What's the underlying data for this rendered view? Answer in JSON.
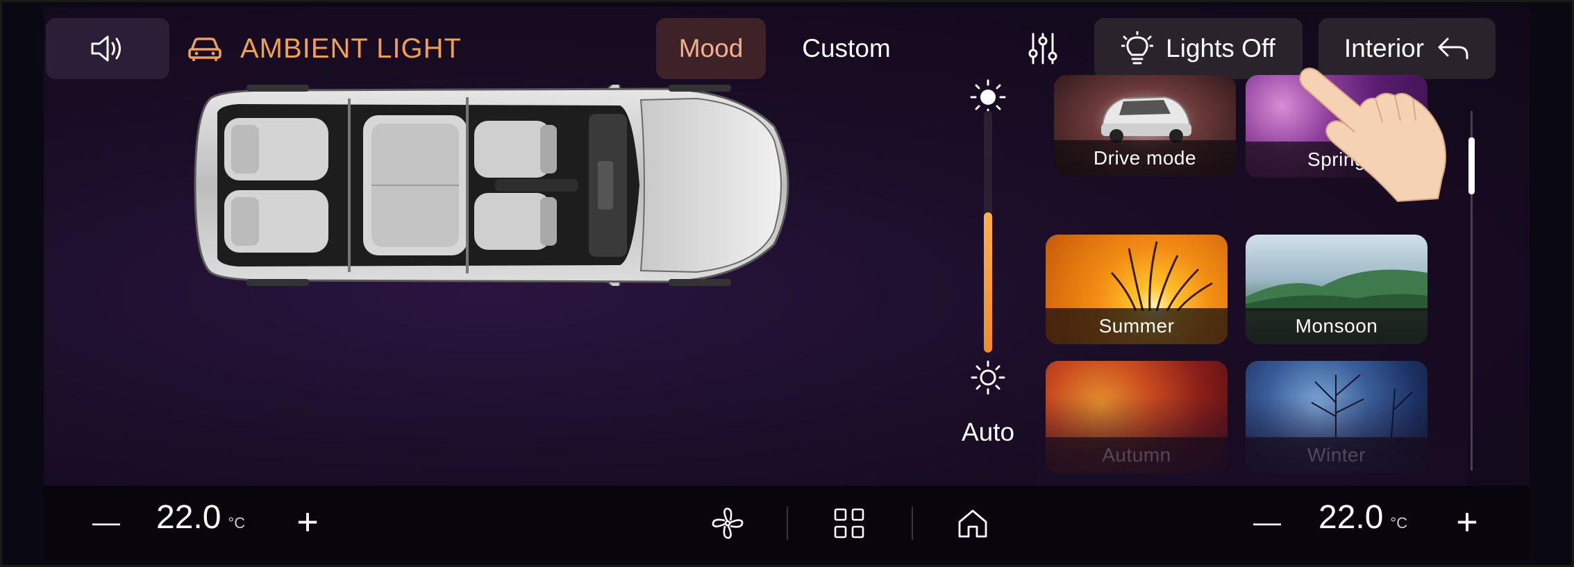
{
  "header": {
    "title": "AMBIENT LIGHT",
    "sound_icon": "speaker-volume-icon",
    "car_icon": "car-icon",
    "tabs": [
      {
        "label": "Mood",
        "active": true
      },
      {
        "label": "Custom",
        "active": false
      }
    ],
    "equalizer_icon": "sliders-icon",
    "lights_button": {
      "label": "Lights Off",
      "icon": "bulb-icon"
    },
    "interior_button": {
      "label": "Interior",
      "icon": "back-arrow-icon"
    }
  },
  "brightness": {
    "auto_label": "Auto",
    "level": 0.58,
    "high_icon": "sun-filled-icon",
    "low_icon": "sun-outline-icon"
  },
  "moods": [
    {
      "label": "Drive mode"
    },
    {
      "label": "Spring"
    },
    {
      "label": "Summer"
    },
    {
      "label": "Monsoon"
    },
    {
      "label": "Autumn"
    },
    {
      "label": "Winter"
    }
  ],
  "climate": {
    "left": {
      "value": "22.0",
      "unit": "°C",
      "minus": "—",
      "plus": "+"
    },
    "right": {
      "value": "22.0",
      "unit": "°C",
      "minus": "—",
      "plus": "+"
    },
    "fan_icon": "fan-icon",
    "grid_icon": "apps-grid-icon",
    "home_icon": "home-icon"
  },
  "colors": {
    "accent": "#f0a14e",
    "active_tab_bg": "#3d2328",
    "background": "#1a0d26"
  }
}
